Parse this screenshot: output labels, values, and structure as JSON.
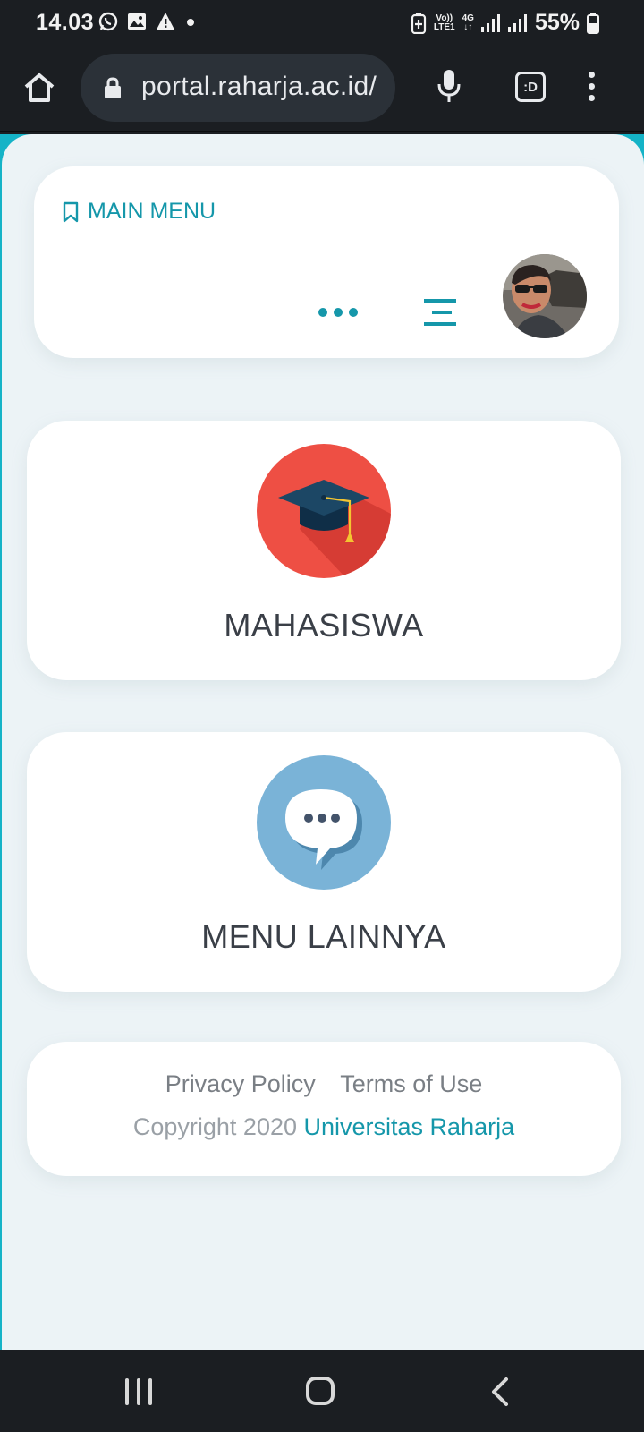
{
  "status_bar": {
    "time": "14.03",
    "volte_label": "Vo))",
    "lte_label": "LTE1",
    "network": "4G",
    "battery": "55%",
    "icons": [
      "whatsapp-icon",
      "gallery-icon",
      "warning-icon",
      "dot-icon",
      "battery-saver-icon",
      "signal-icon",
      "battery-icon"
    ]
  },
  "browser": {
    "url": "portal.raharja.ac.id/",
    "tab_label": ":D"
  },
  "header": {
    "title": "MAIN MENU"
  },
  "menu": {
    "mahasiswa": "MAHASISWA",
    "lainnya": "MENU LAINNYA"
  },
  "footer": {
    "privacy": "Privacy Policy",
    "terms": "Terms of Use",
    "copyright": "Copyright 2020",
    "brand": "Universitas Raharja"
  },
  "colors": {
    "accent": "#1597aa",
    "page_bg": "#ecf3f6",
    "graduation_red": "#ee4f44",
    "chat_blue": "#7ab3d7",
    "top_teal": "#15b3c7"
  }
}
